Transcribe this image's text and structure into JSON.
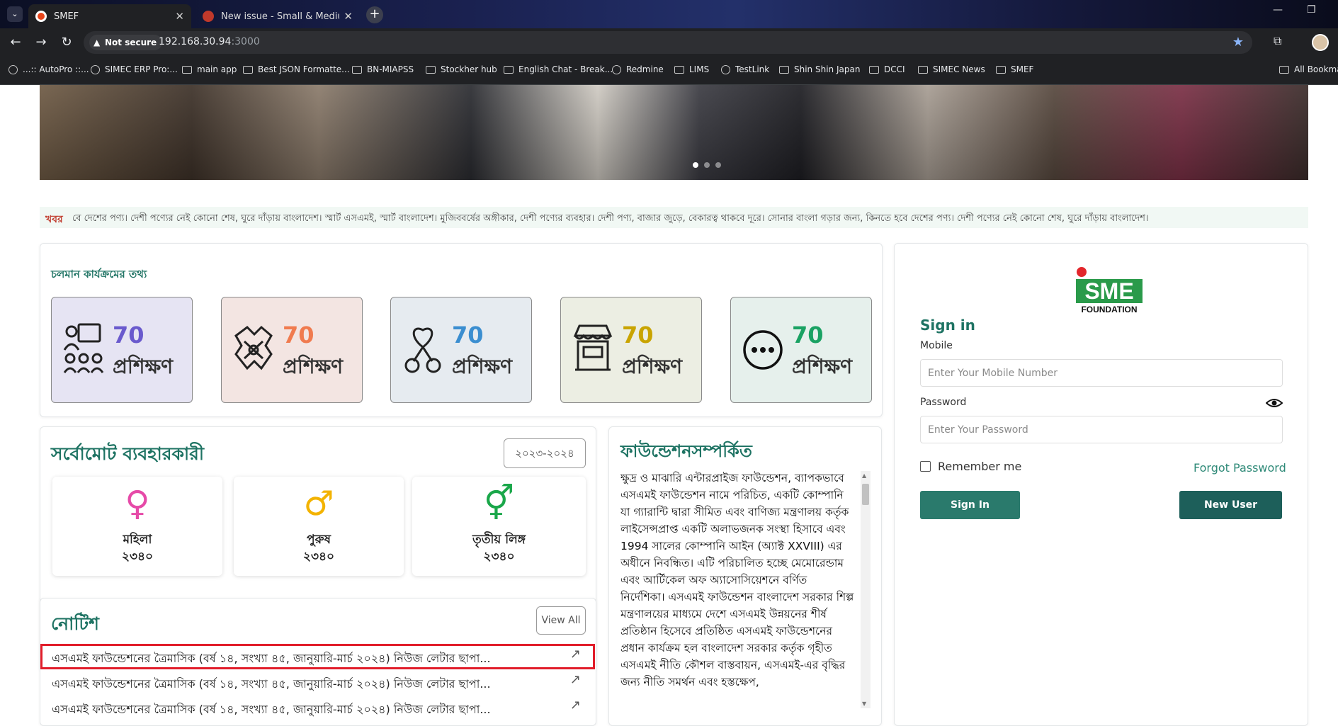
{
  "browser": {
    "tabs": [
      {
        "title": "SMEF",
        "active": true
      },
      {
        "title": "New issue - Small & Medium E",
        "active": false
      }
    ],
    "address": {
      "security": "Not secure",
      "host": "192.168.30.94",
      "port": ":3000"
    },
    "bookmarks": [
      "...:: AutoPro ::...",
      "SIMEC ERP Pro:...",
      "main app",
      "Best JSON Formatte...",
      "BN-MIAPSS",
      "Stockher hub",
      "English Chat - Break...",
      "Redmine",
      "LIMS",
      "TestLink",
      "Shin Shin Japan",
      "DCCI",
      "SIMEC News",
      "SMEF",
      "All Bookma"
    ]
  },
  "ticker": {
    "label": "খবর",
    "text": "বে দেশের পণ্য। দেশী পণ্যের নেই কোনো শেষ, ঘুরে দাঁড়ায় বাংলাদেশ। স্মার্ট এসএমই, স্মার্ট বাংলাদেশ। মুজিববর্ষের অঙ্গীকার, দেশী পণ্যের ব্যবহার। দেশী পণ্য, বাজার জুড়ে, বেকারত্ব থাকবে দূরে। সোনার বাংলা গড়ার জন্য, কিনতে হবে দেশের পণ্য। দেশী পণ্যের নেই কোনো শেষ, ঘুরে দাঁড়ায় বাংলাদেশ।"
  },
  "ongoing": {
    "title": "চলমান কার্যক্রমের তথ্য",
    "stats": [
      {
        "icon": "training-icon",
        "value": "70",
        "label": "প্রশিক্ষণ",
        "color": "#6a5acd",
        "bg": "#e6e4f3"
      },
      {
        "icon": "handshake-icon",
        "value": "70",
        "label": "প্রশিক্ষণ",
        "color": "#f07b4f",
        "bg": "#f3e5e2"
      },
      {
        "icon": "ribbon-icon",
        "value": "70",
        "label": "প্রশিক্ষণ",
        "color": "#3b8ed0",
        "bg": "#e6ebf0"
      },
      {
        "icon": "shop-icon",
        "value": "70",
        "label": "প্রশিক্ষণ",
        "color": "#c9a400",
        "bg": "#eceee3"
      },
      {
        "icon": "more-icon",
        "value": "70",
        "label": "প্রশিক্ষণ",
        "color": "#1aa263",
        "bg": "#e6f0ec"
      }
    ]
  },
  "users": {
    "title": "সর্বোমোট ব্যবহারকারী",
    "year": "২০২৩-২০২৪",
    "genders": [
      {
        "icon": "female-icon",
        "symbol": "♀",
        "label": "মহিলা",
        "value": "২৩৪০",
        "color": "#e64aa8"
      },
      {
        "icon": "male-icon",
        "symbol": "♂",
        "label": "পুরুষ",
        "value": "২৩৪০",
        "color": "#f3b300"
      },
      {
        "icon": "third-gender-icon",
        "symbol": "⚥",
        "label": "তৃতীয় লিঙ্গ",
        "value": "২৩৪০",
        "color": "#1aa74a"
      }
    ]
  },
  "notice": {
    "title": "নোটিশ",
    "view_all": "View All",
    "items": [
      "এসএমই ফাউন্ডেশনের ত্রৈমাসিক (বর্ষ ১৪, সংখ্যা ৪৫, জানুয়ারি-মার্চ ২০২৪) নিউজ লেটার ছাপা...",
      "এসএমই ফাউন্ডেশনের ত্রৈমাসিক (বর্ষ ১৪, সংখ্যা ৪৫, জানুয়ারি-মার্চ ২০২৪) নিউজ লেটার ছাপা...",
      "এসএমই ফাউন্ডেশনের ত্রৈমাসিক (বর্ষ ১৪, সংখ্যা ৪৫, জানুয়ারি-মার্চ ২০২৪) নিউজ লেটার ছাপা..."
    ],
    "selected_index": 0
  },
  "about": {
    "title": "ফাউন্ডেশনসম্পর্কিত",
    "text": "ক্ষুদ্র ও মাঝারি এন্টারপ্রাইজ ফাউন্ডেশন, ব্যাপকভাবে এসএমই ফাউন্ডেশন নামে পরিচিত, একটি কোম্পানি যা গ্যারান্টি দ্বারা সীমিত এবং বাণিজ্য মন্ত্রণালয় কর্তৃক লাইসেন্সপ্রাপ্ত একটি অলাভজনক সংস্থা হিসাবে এবং 1994 সালের কোম্পানি আইন (অ্যাক্ট XXVIII) এর অধীনে নিবন্ধিত। এটি পরিচালিত হচ্ছে মেমোরেন্ডাম এবং আর্টিকেল অফ অ্যাসোসিয়েশনে বর্ণিত নির্দেশিকা। এসএমই ফাউন্ডেশন বাংলাদেশ সরকার শিল্প মন্ত্রণালয়ের মাধ্যমে দেশে এসএমই উন্নয়নের শীর্ষ প্রতিষ্ঠান হিসেবে প্রতিষ্ঠিত এসএমই ফাউন্ডেশনের প্রধান কার্যক্রম হল বাংলাদেশ সরকার কর্তৃক গৃহীত এসএমই নীতি কৌশল বাস্তবায়ন, এসএমই-এর বৃদ্ধির জন্য নীতি সমর্থন এবং হস্তক্ষেপ,"
  },
  "login": {
    "logo_text": "SME",
    "logo_sub": "FOUNDATION",
    "title": "Sign in",
    "mobile_label": "Mobile",
    "mobile_placeholder": "Enter Your Mobile Number",
    "password_label": "Password",
    "password_placeholder": "Enter Your Password",
    "remember": "Remember me",
    "forgot": "Forgot Password",
    "signin_button": "Sign In",
    "newuser_button": "New User"
  }
}
